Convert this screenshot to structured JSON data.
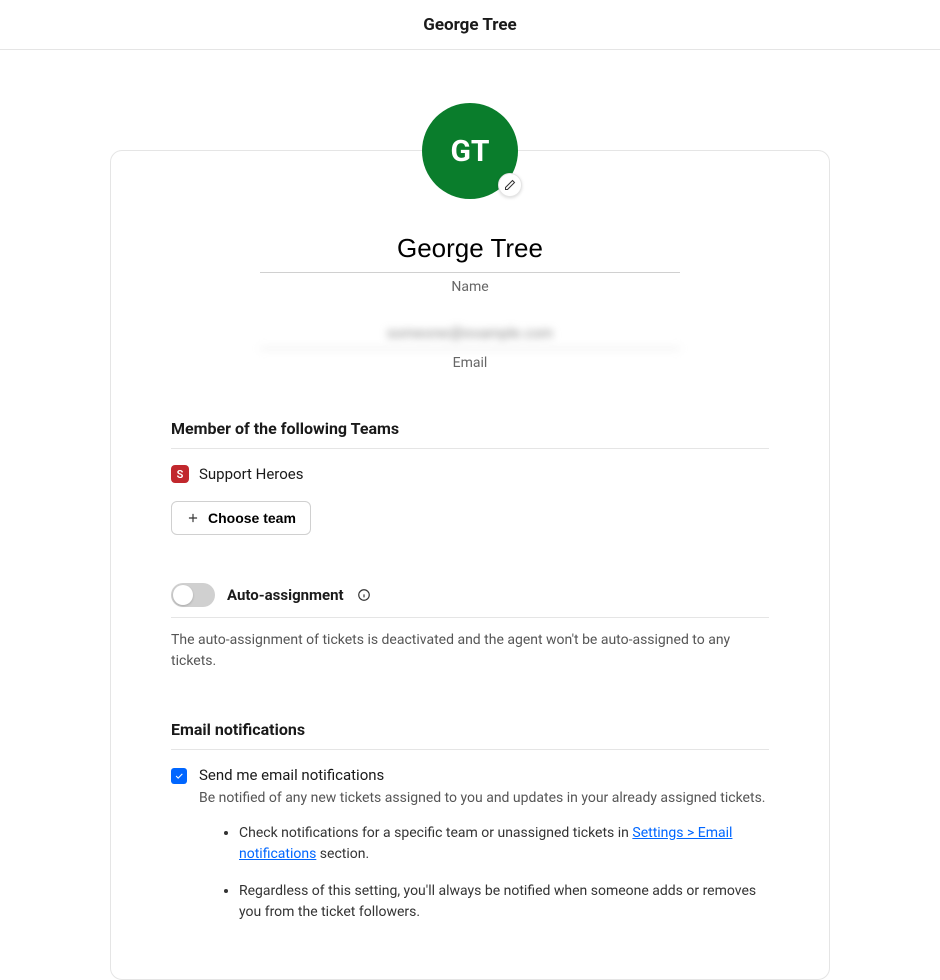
{
  "header": {
    "title": "George Tree"
  },
  "profile": {
    "avatar_initials": "GT",
    "name_value": "George Tree",
    "name_label": "Name",
    "email_value": "someone@example.com",
    "email_label": "Email"
  },
  "teams": {
    "section_title": "Member of the following Teams",
    "items": [
      {
        "badge_letter": "S",
        "name": "Support Heroes"
      }
    ],
    "choose_button": "Choose team"
  },
  "auto_assignment": {
    "label": "Auto-assignment",
    "enabled": false,
    "description": "The auto-assignment of tickets is deactivated and the agent won't be auto-assigned to any tickets."
  },
  "email_notifications": {
    "section_title": "Email notifications",
    "checkbox_checked": true,
    "checkbox_label": "Send me email notifications",
    "checkbox_desc": "Be notified of any new tickets assigned to you and updates in your already assigned tickets.",
    "bullets": [
      {
        "prefix": "Check notifications for a specific team or unassigned tickets in ",
        "link": "Settings > Email notifications",
        "suffix": " section."
      },
      {
        "prefix": "Regardless of this setting, you'll always be notified when someone adds or removes you from the ticket followers.",
        "link": "",
        "suffix": ""
      }
    ]
  }
}
